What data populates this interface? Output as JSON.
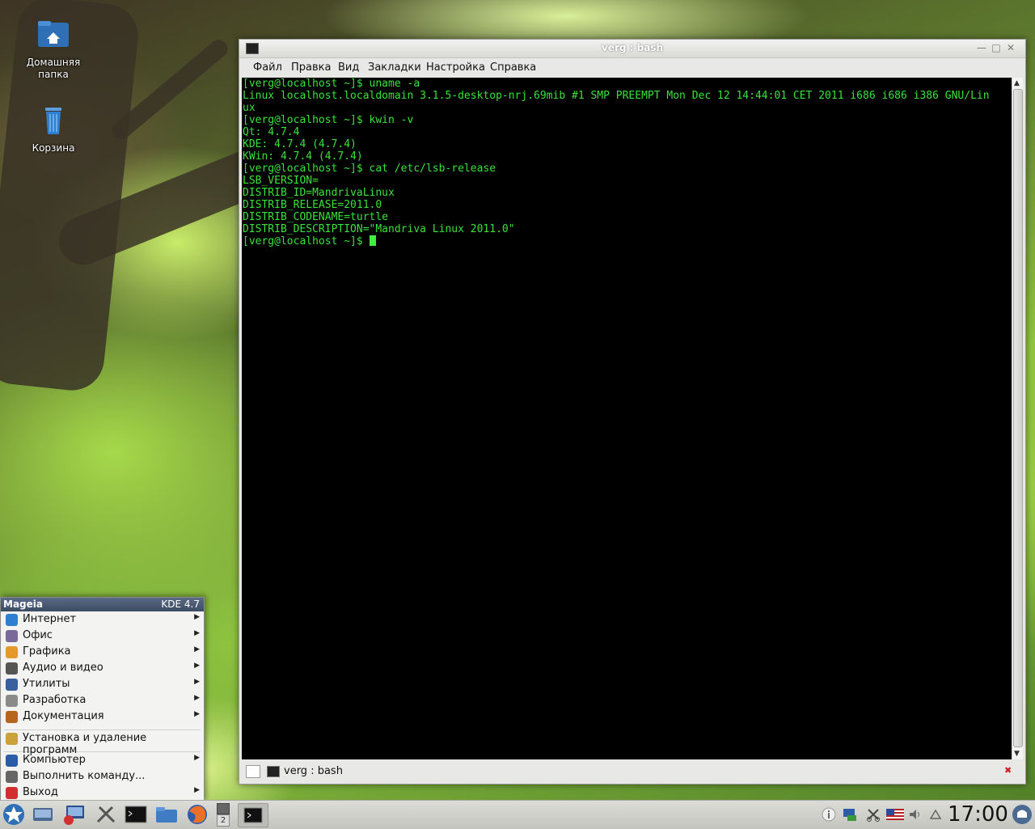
{
  "desktop": {
    "icons": [
      {
        "label": "Домашняя папка",
        "icon": "home-folder-icon"
      },
      {
        "label": "Корзина",
        "icon": "trash-icon"
      }
    ]
  },
  "window": {
    "title": "verg : bash",
    "menu": [
      "Файл",
      "Правка",
      "Вид",
      "Закладки",
      "Настройка",
      "Справка"
    ],
    "tab_label": "verg : bash"
  },
  "terminal": {
    "text_color": "#39e23a",
    "lines": [
      "[verg@localhost ~]$ uname -a",
      "Linux localhost.localdomain 3.1.5-desktop-nrj.69mib #1 SMP PREEMPT Mon Dec 12 14:44:01 CET 2011 i686 i686 i386 GNU/Lin",
      "ux",
      "[verg@localhost ~]$ kwin -v",
      "Qt: 4.7.4",
      "KDE: 4.7.4 (4.7.4)",
      "KWin: 4.7.4 (4.7.4)",
      "[verg@localhost ~]$ cat /etc/lsb-release",
      "LSB_VERSION=",
      "DISTRIB_ID=MandrivaLinux",
      "DISTRIB_RELEASE=2011.0",
      "DISTRIB_CODENAME=turtle",
      "DISTRIB_DESCRIPTION=\"Mandriva Linux 2011.0\"",
      "[verg@localhost ~]$ "
    ]
  },
  "start_menu": {
    "brand": "Mageia",
    "version": "KDE 4.7",
    "groups": [
      [
        {
          "label": "Интернет",
          "icon": "globe-icon",
          "color": "#2f7fd0",
          "submenu": true
        },
        {
          "label": "Офис",
          "icon": "office-icon",
          "color": "#7a6a9a",
          "submenu": true
        },
        {
          "label": "Графика",
          "icon": "palette-icon",
          "color": "#e39a2a",
          "submenu": true
        },
        {
          "label": "Аудио и видео",
          "icon": "film-icon",
          "color": "#555555",
          "submenu": true
        },
        {
          "label": "Утилиты",
          "icon": "utilities-icon",
          "color": "#3a5fa0",
          "submenu": true
        },
        {
          "label": "Разработка",
          "icon": "tools-icon",
          "color": "#8a8a8a",
          "submenu": true
        },
        {
          "label": "Документация",
          "icon": "book-icon",
          "color": "#b5651d",
          "submenu": true
        }
      ],
      [
        {
          "label": "Установка и удаление программ",
          "icon": "package-icon",
          "color": "#c9a33a",
          "submenu": false
        }
      ],
      [
        {
          "label": "Компьютер",
          "icon": "computer-icon",
          "color": "#2b5ca8",
          "submenu": true
        },
        {
          "label": "Выполнить команду...",
          "icon": "run-command-icon",
          "color": "#666666",
          "submenu": false
        },
        {
          "label": "Выход",
          "icon": "power-icon",
          "color": "#d03030",
          "submenu": true
        }
      ]
    ]
  },
  "taskbar": {
    "launchers": [
      {
        "name": "mageia-star-icon"
      },
      {
        "name": "show-desktop-icon"
      },
      {
        "name": "computer-settings-icon"
      },
      {
        "name": "system-tools-icon"
      },
      {
        "name": "terminal-launcher-icon"
      },
      {
        "name": "file-manager-icon"
      },
      {
        "name": "firefox-icon"
      }
    ],
    "pager_label": "2",
    "tray": [
      "info-icon",
      "network-icon",
      "clipboard-icon",
      "keyboard-layout-flag-icon",
      "volume-icon",
      "tray-expand-icon"
    ],
    "clock": "17:00"
  }
}
